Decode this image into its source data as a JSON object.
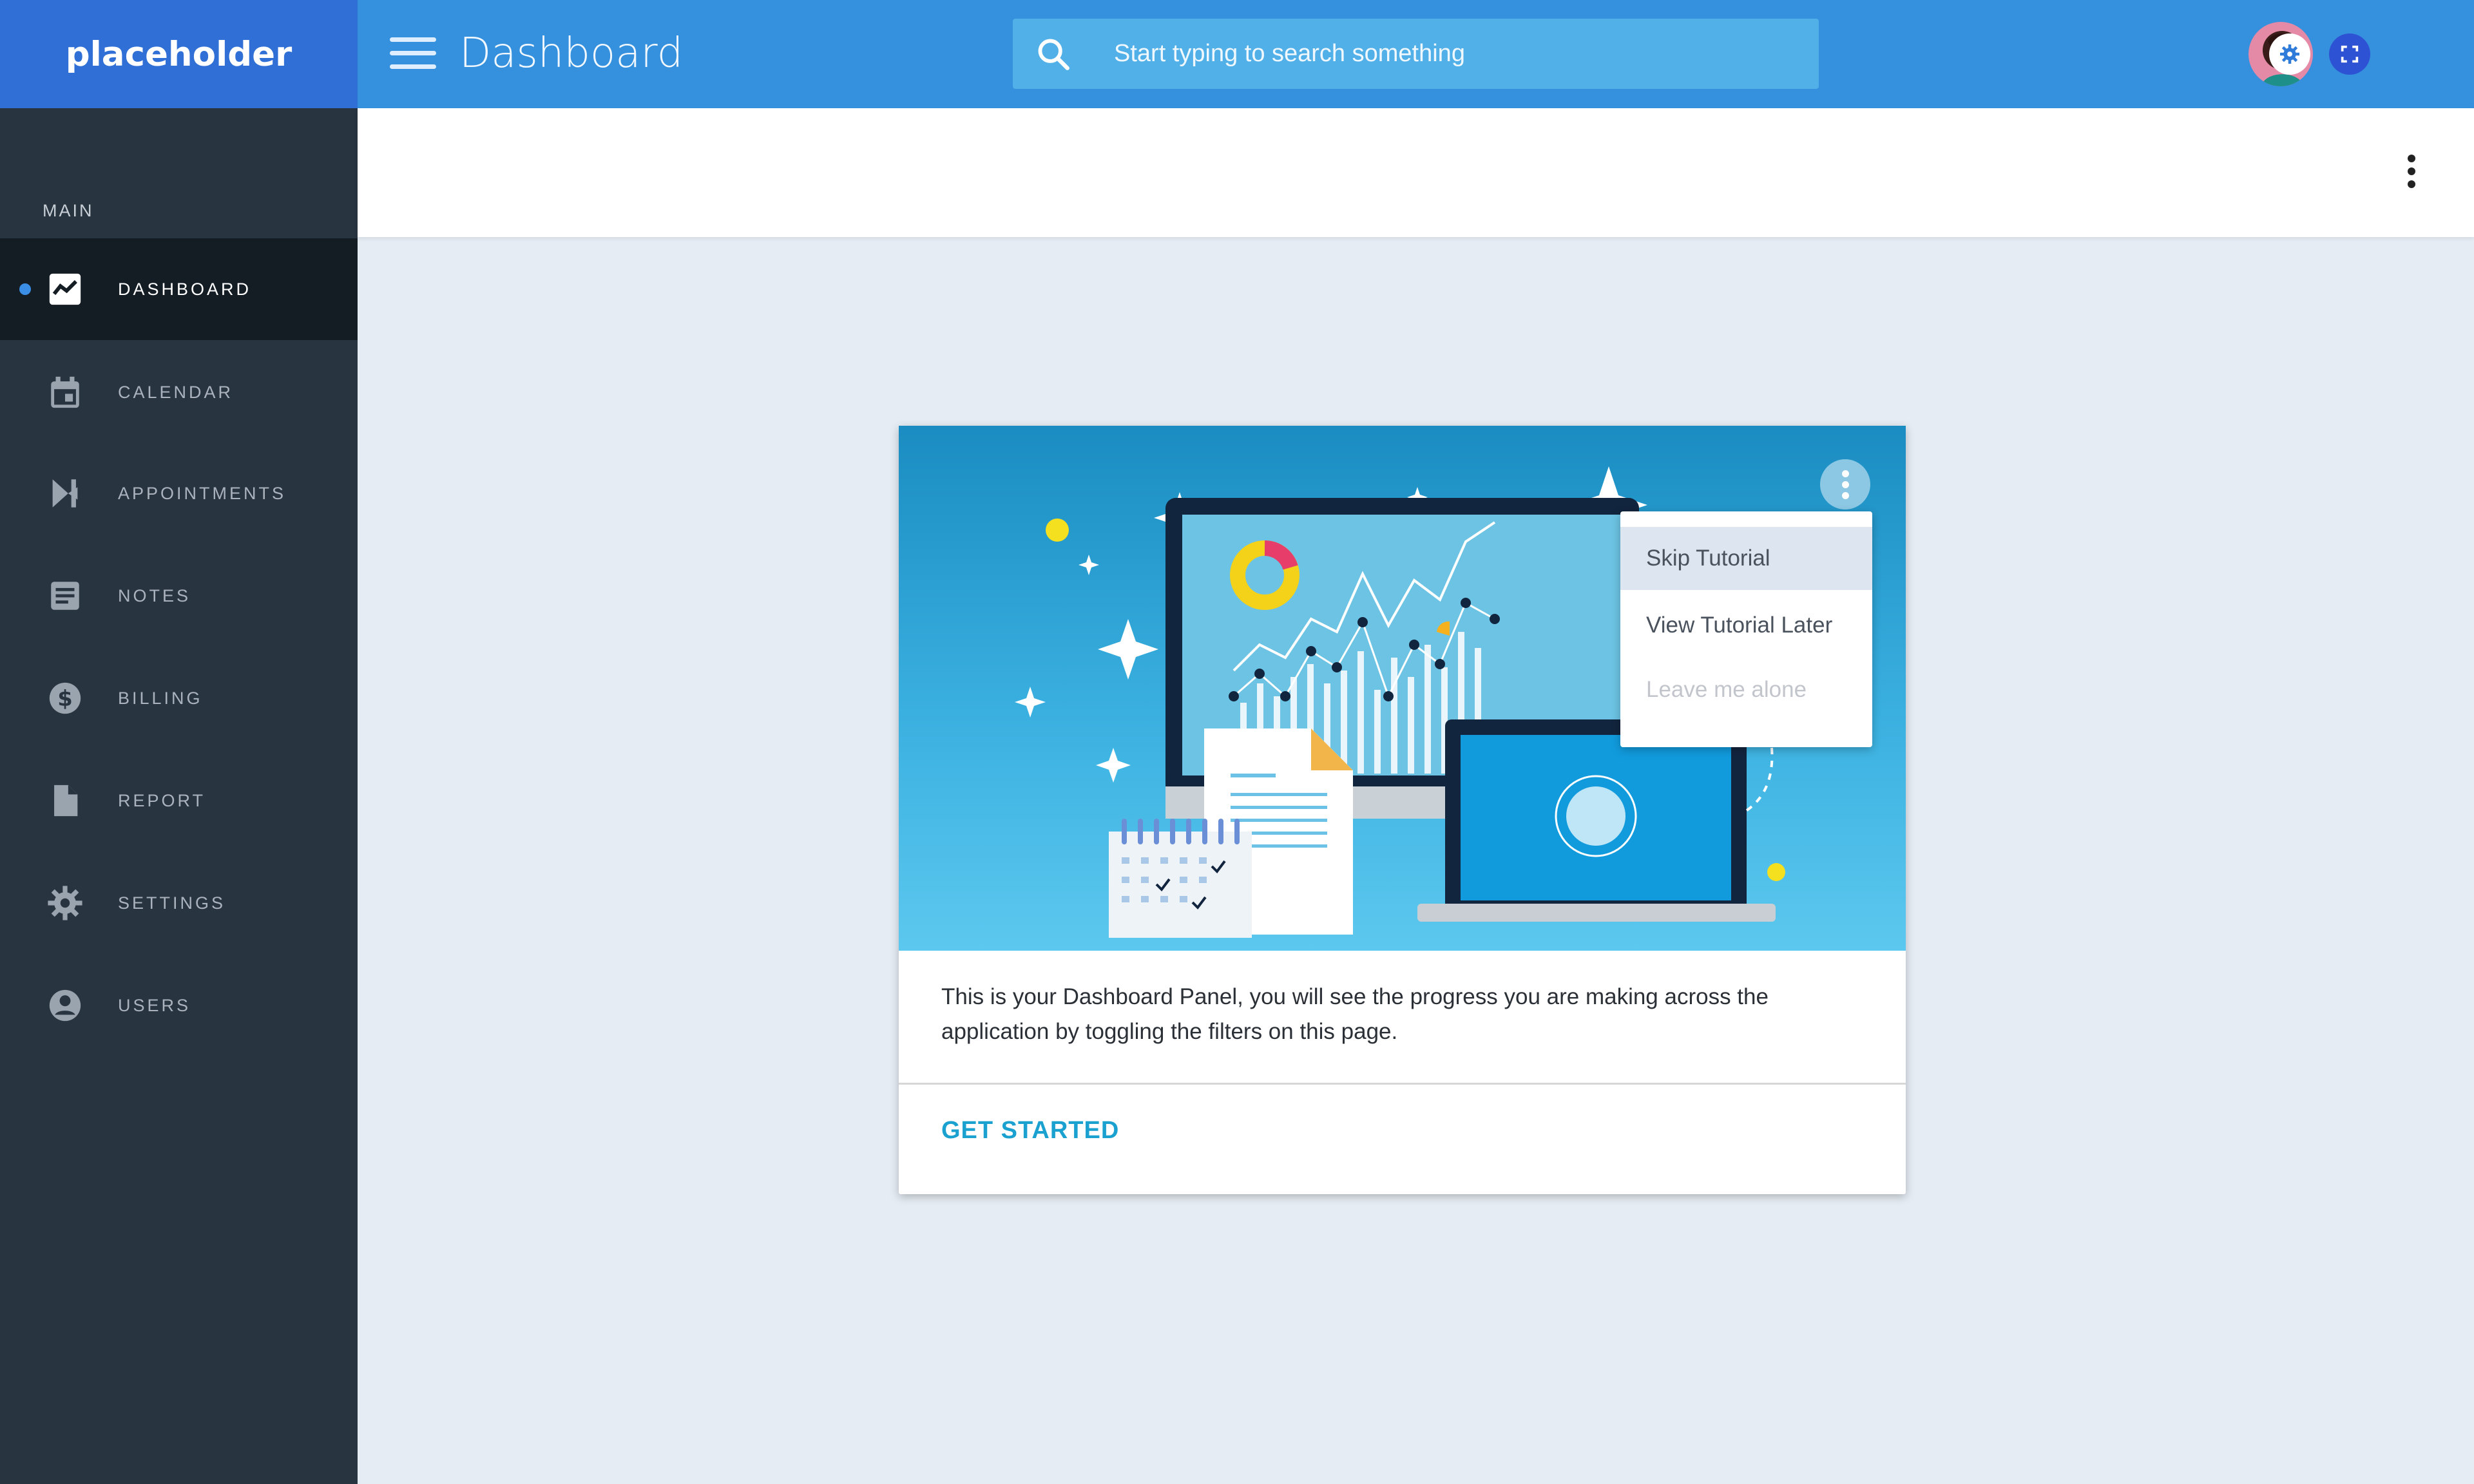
{
  "brand": "placeholder",
  "sidebar": {
    "section_label": "MAIN",
    "items": [
      {
        "label": "DASHBOARD",
        "icon": "chart-line-icon",
        "active": true
      },
      {
        "label": "CALENDAR",
        "icon": "calendar-icon"
      },
      {
        "label": "APPOINTMENTS",
        "icon": "appointments-icon"
      },
      {
        "label": "NOTES",
        "icon": "notes-icon"
      },
      {
        "label": "BILLING",
        "icon": "dollar-icon"
      },
      {
        "label": "REPORT",
        "icon": "file-icon"
      },
      {
        "label": "SETTINGS",
        "icon": "gear-icon"
      },
      {
        "label": "USERS",
        "icon": "user-circle-icon"
      }
    ]
  },
  "header": {
    "title": "Dashboard",
    "search_placeholder": "Start typing to search something"
  },
  "card": {
    "description": "This is your Dashboard Panel, you will see the progress you are making across the application by toggling the filters on this page.",
    "cta": "GET STARTED"
  },
  "menu": {
    "items": [
      {
        "label": "Skip Tutorial",
        "state": "hover"
      },
      {
        "label": "View Tutorial Later",
        "state": "normal"
      },
      {
        "label": "Leave me alone",
        "state": "disabled"
      }
    ]
  },
  "colors": {
    "brand": "#2f6fd6",
    "topbar": "#3590de",
    "sidebar": "#283440",
    "accent": "#1aa1cf",
    "content_bg": "#e6ecf4"
  }
}
